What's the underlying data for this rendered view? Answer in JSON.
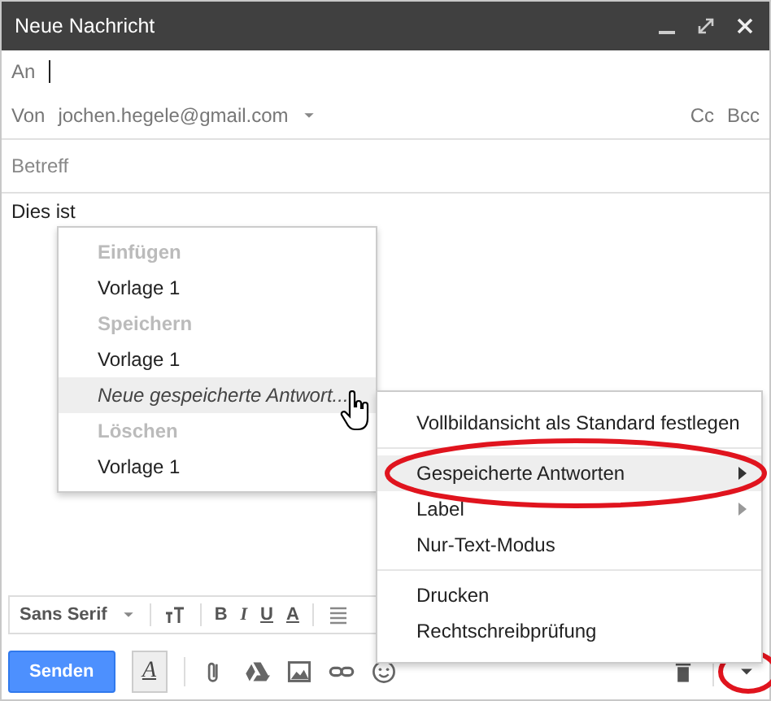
{
  "window": {
    "title": "Neue Nachricht"
  },
  "to": {
    "label": "An"
  },
  "from": {
    "label": "Von",
    "value": "jochen.hegele@gmail.com",
    "cc": "Cc",
    "bcc": "Bcc"
  },
  "subject": {
    "placeholder": "Betreff"
  },
  "body": {
    "text": "Dies ist"
  },
  "submenu": {
    "items": [
      {
        "kind": "header",
        "label": "Einfügen",
        "selected": false
      },
      {
        "kind": "item",
        "label": "Vorlage 1",
        "selected": false
      },
      {
        "kind": "header",
        "label": "Speichern",
        "selected": false
      },
      {
        "kind": "item",
        "label": "Vorlage 1",
        "selected": false
      },
      {
        "kind": "action",
        "label": "Neue gespeicherte Antwort...",
        "selected": true
      },
      {
        "kind": "header",
        "label": "Löschen",
        "selected": false
      },
      {
        "kind": "item",
        "label": "Vorlage 1",
        "selected": false
      }
    ]
  },
  "menu": {
    "groups": [
      [
        {
          "label": "Vollbildansicht als Standard festlegen",
          "selected": false,
          "submenu": false,
          "circled": false
        }
      ],
      [
        {
          "label": "Gespeicherte Antworten",
          "selected": true,
          "submenu": true,
          "circled": true
        },
        {
          "label": "Label",
          "selected": false,
          "submenu": true,
          "circled": false
        },
        {
          "label": "Nur-Text-Modus",
          "selected": false,
          "submenu": false,
          "circled": false
        }
      ],
      [
        {
          "label": "Drucken",
          "selected": false,
          "submenu": false,
          "circled": false
        },
        {
          "label": "Rechtschreibprüfung",
          "selected": false,
          "submenu": false,
          "circled": false
        }
      ]
    ]
  },
  "format_toolbar": {
    "font": "Sans Serif",
    "bold": "B",
    "italic": "I",
    "underline": "U",
    "text_color": "A"
  },
  "bottom_bar": {
    "send": "Senden",
    "format_button": {
      "label": "A",
      "selected": true
    },
    "more_circled": true
  }
}
